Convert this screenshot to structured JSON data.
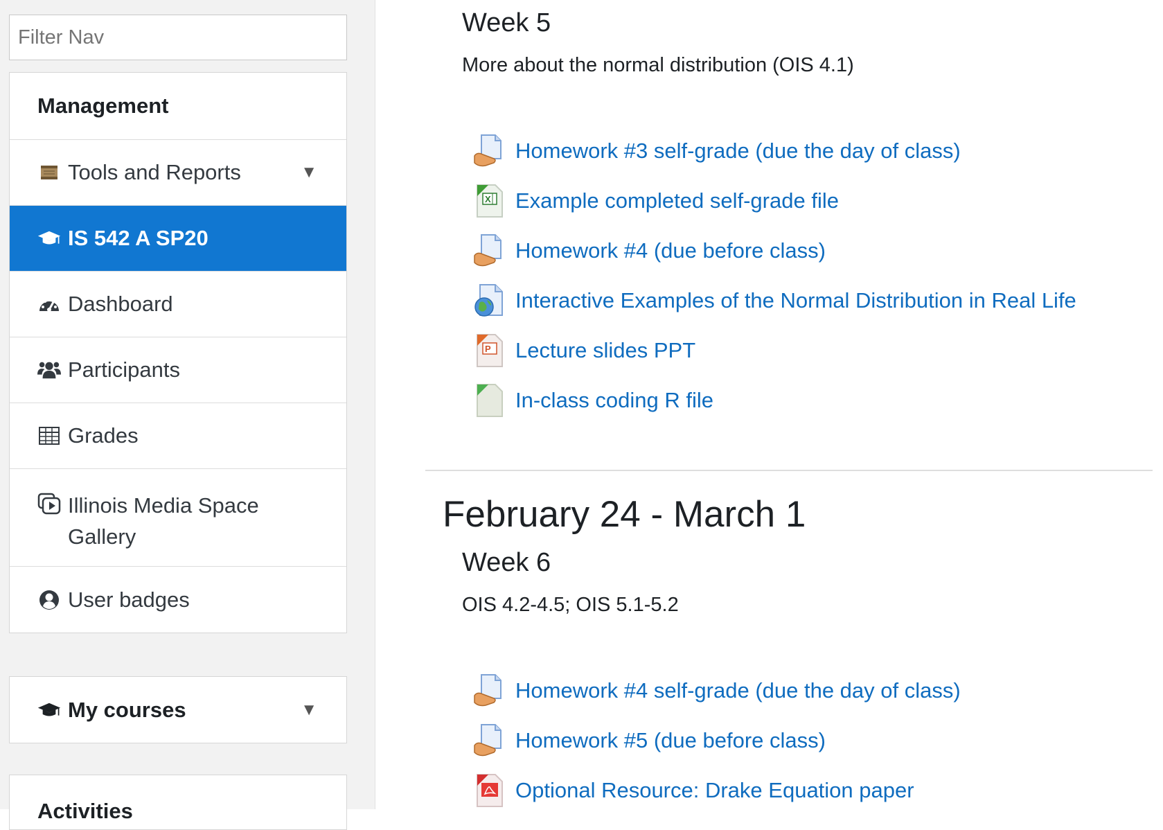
{
  "sidebar": {
    "filter_placeholder": "Filter Nav",
    "management_label": "Management",
    "items": [
      {
        "label": "Tools and Reports"
      },
      {
        "label": "IS 542 A SP20"
      },
      {
        "label": "Dashboard"
      },
      {
        "label": "Participants"
      },
      {
        "label": "Grades"
      },
      {
        "label": "Illinois Media Space Gallery",
        "line1": "Illinois Media Space",
        "line2": "Gallery"
      },
      {
        "label": "User badges"
      }
    ],
    "my_courses_label": "My courses",
    "activities_label": "Activities",
    "active_color": "#1177d1"
  },
  "main": {
    "week5": {
      "title": "Week 5",
      "summary": "More about the normal distribution (OIS 4.1)",
      "activities": [
        {
          "icon": "assignment-icon",
          "label": "Homework #3 self-grade (due the day of class)"
        },
        {
          "icon": "excel-file-icon",
          "label": "Example completed self-grade file"
        },
        {
          "icon": "assignment-icon",
          "label": "Homework #4 (due before class)"
        },
        {
          "icon": "url-link-icon",
          "label": "Interactive Examples of the Normal Distribution in Real Life"
        },
        {
          "icon": "powerpoint-file-icon",
          "label": "Lecture slides PPT"
        },
        {
          "icon": "generic-file-icon",
          "label": "In-class coding R file"
        }
      ]
    },
    "section2": {
      "title": "February 24 - March 1",
      "week_title": "Week 6",
      "summary": "OIS 4.2-4.5; OIS 5.1-5.2",
      "activities": [
        {
          "icon": "assignment-icon",
          "label": "Homework #4 self-grade (due the day of class)"
        },
        {
          "icon": "assignment-icon",
          "label": "Homework #5 (due before class)"
        },
        {
          "icon": "pdf-file-icon",
          "label": "Optional Resource: Drake Equation paper"
        }
      ]
    },
    "link_color": "#0f6cbf"
  }
}
